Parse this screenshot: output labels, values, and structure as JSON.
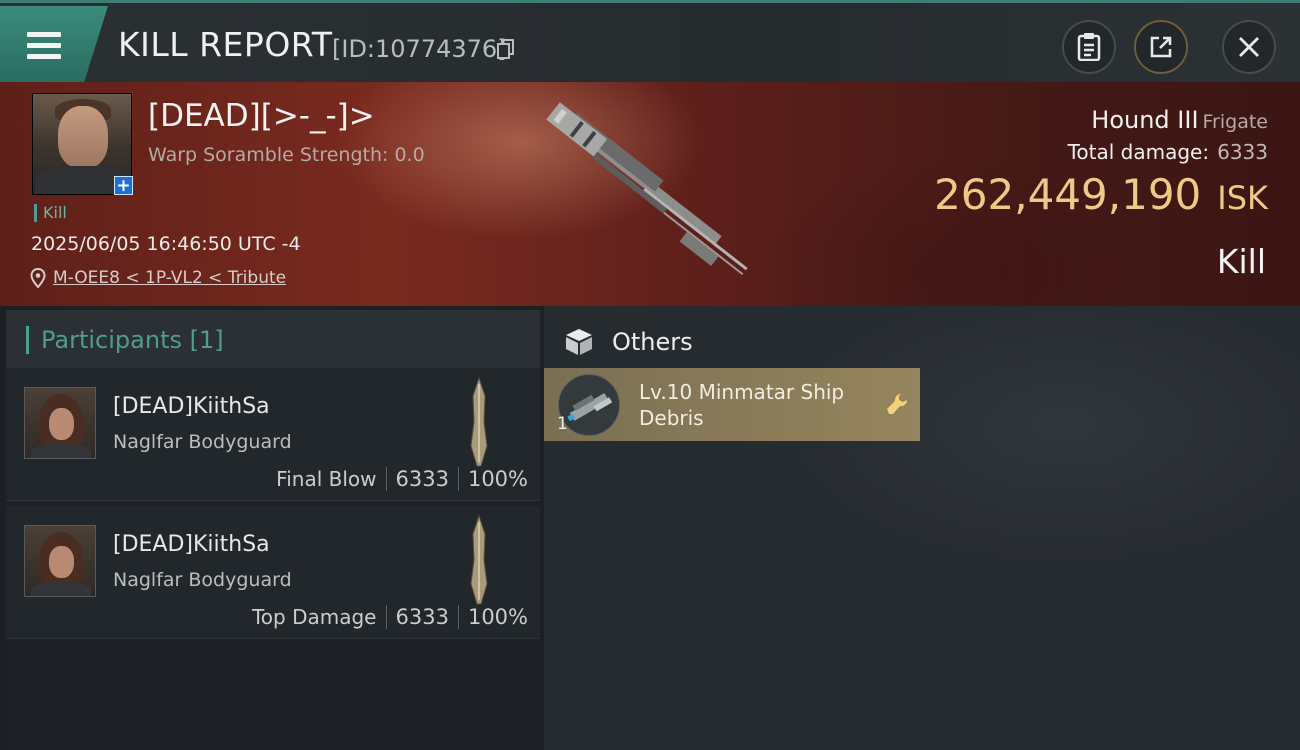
{
  "header": {
    "title": "KILL REPORT",
    "report_id": "[ID:10774376]"
  },
  "victim": {
    "name": "[DEAD][>-_-]>",
    "warp_scramble": "Warp Soramble Strength: 0.0",
    "kill_tag": "Kill",
    "datetime": "2025/06/05 16:46:50 UTC -4",
    "location": "M-OEE8 < 1P-VL2 < Tribute",
    "ship_name": "Hound III",
    "ship_class": "Frigate",
    "total_damage_label": "Total damage:",
    "total_damage": "6333",
    "isk_value": "262,449,190",
    "isk_unit": "ISK",
    "result": "Kill"
  },
  "participants": {
    "header": "Participants [1]",
    "items": [
      {
        "name": "[DEAD]KiithSa",
        "corp": "Naglfar Bodyguard",
        "label": "Final Blow",
        "damage": "6333",
        "percent": "100%"
      },
      {
        "name": "[DEAD]KiithSa",
        "corp": "Naglfar Bodyguard",
        "label": "Top Damage",
        "damage": "6333",
        "percent": "100%"
      }
    ]
  },
  "others": {
    "title": "Others",
    "items": [
      {
        "qty": "1",
        "name": "Lv.10 Minmatar Ship Debris"
      }
    ]
  },
  "colors": {
    "accent": "#4aa090",
    "isk": "#efc987",
    "item_card": "#95855e"
  }
}
